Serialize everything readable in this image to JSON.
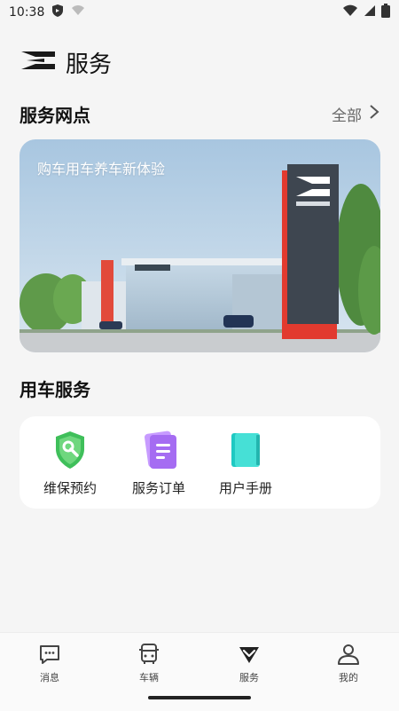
{
  "status_bar": {
    "time": "10:38"
  },
  "header": {
    "title": "服务"
  },
  "outlets": {
    "section_title": "服务网点",
    "see_all_label": "全部",
    "banner_text": "购车用车养车新体验"
  },
  "vehicle_services": {
    "section_title": "用车服务",
    "items": [
      {
        "label": "维保预约",
        "icon": "maintenance-shield-icon"
      },
      {
        "label": "服务订单",
        "icon": "service-order-icon"
      },
      {
        "label": "用户手册",
        "icon": "user-manual-icon"
      }
    ]
  },
  "bottom_nav": {
    "items": [
      {
        "label": "消息",
        "icon": "message-icon"
      },
      {
        "label": "车辆",
        "icon": "car-icon"
      },
      {
        "label": "服务",
        "icon": "service-icon",
        "active": true
      },
      {
        "label": "我的",
        "icon": "profile-icon"
      }
    ]
  },
  "colors": {
    "background": "#f5f5f5",
    "card": "#ffffff",
    "brand_red": "#e53935",
    "text_primary": "#111111",
    "text_secondary": "#666666"
  }
}
